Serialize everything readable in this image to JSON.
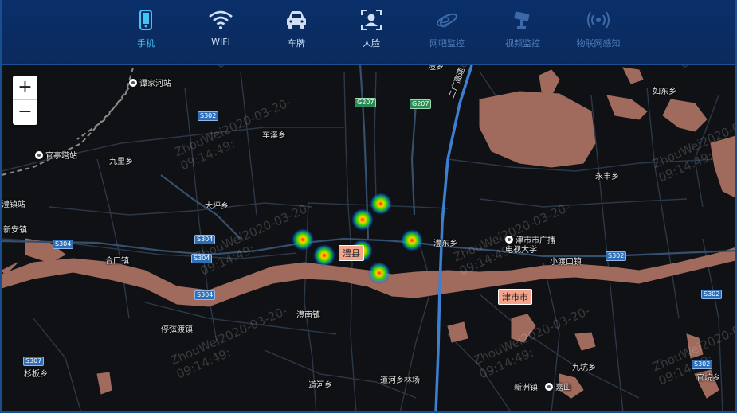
{
  "nav": {
    "items": [
      {
        "label": "手机",
        "icon": "phone-icon",
        "state": "active"
      },
      {
        "label": "WIFI",
        "icon": "wifi-icon",
        "state": "normal"
      },
      {
        "label": "车牌",
        "icon": "car-icon",
        "state": "normal"
      },
      {
        "label": "人脸",
        "icon": "face-icon",
        "state": "normal"
      },
      {
        "label": "网吧监控",
        "icon": "ie-browser-icon",
        "state": "dim"
      },
      {
        "label": "视频监控",
        "icon": "camera-icon",
        "state": "dim"
      },
      {
        "label": "物联网感知",
        "icon": "iot-signal-icon",
        "state": "dim"
      }
    ],
    "colors": {
      "bar": "#0b2a5c",
      "active": "#43c4f2",
      "normal": "#cfe0f5",
      "dim": "#4f7bb8"
    }
  },
  "zoom": {
    "in_label": "+",
    "out_label": "−"
  },
  "map": {
    "colors": {
      "background": "#0f1114",
      "water": "#a06a5d",
      "road": "#2c3848",
      "highway": "#3d7fd1"
    },
    "place_labels": {
      "tanjiahe": "谭家河站",
      "guantingta": "官亭塔站",
      "chexi": "车溪乡",
      "jiuli": "九里乡",
      "daping": "大坪乡",
      "zhen_station": "澧镇站",
      "xinan": "新安镇",
      "hekou": "合口镇",
      "tingxian": "停弦渡镇",
      "lidong": "澧东乡",
      "jinshi_tv": "津市市广播\n电视大学",
      "xiaodu": "小渡口镇",
      "yongfeng": "永丰乡",
      "rudong": "如东乡",
      "linan": "澧南镇",
      "daohe": "道河乡",
      "daohe_farm": "道河乡林场",
      "jiukeng": "九坑乡",
      "xinzhou": "新洲镇",
      "jiashan": "嘉山",
      "guankeng": "官垸乡",
      "shanban": "杉板乡",
      "tiaodi": "澧乡"
    },
    "expressway": "二广高速",
    "shields": {
      "s302_a": "S302",
      "s304_a": "S304",
      "s304_b": "S304",
      "s304_c": "S304",
      "s304_d": "S304",
      "s302_b": "S302",
      "s302_c": "S302",
      "s302_d": "S302",
      "s307": "S307",
      "g207_a": "G207",
      "g207_b": "G207"
    },
    "cities": {
      "li_county": "澧县",
      "jinshi": "津市市"
    },
    "heat_points": [
      {
        "id": "hp1",
        "intensity": 0.9
      },
      {
        "id": "hp2",
        "intensity": 0.9
      },
      {
        "id": "hp3",
        "intensity": 0.9
      },
      {
        "id": "hp4",
        "intensity": 0.9
      },
      {
        "id": "hp5",
        "intensity": 0.9
      },
      {
        "id": "hp6",
        "intensity": 0.9
      },
      {
        "id": "hp7",
        "intensity": 0.9
      }
    ]
  },
  "watermark": "ZhouWei2020-03-20-\n09:14:49:"
}
